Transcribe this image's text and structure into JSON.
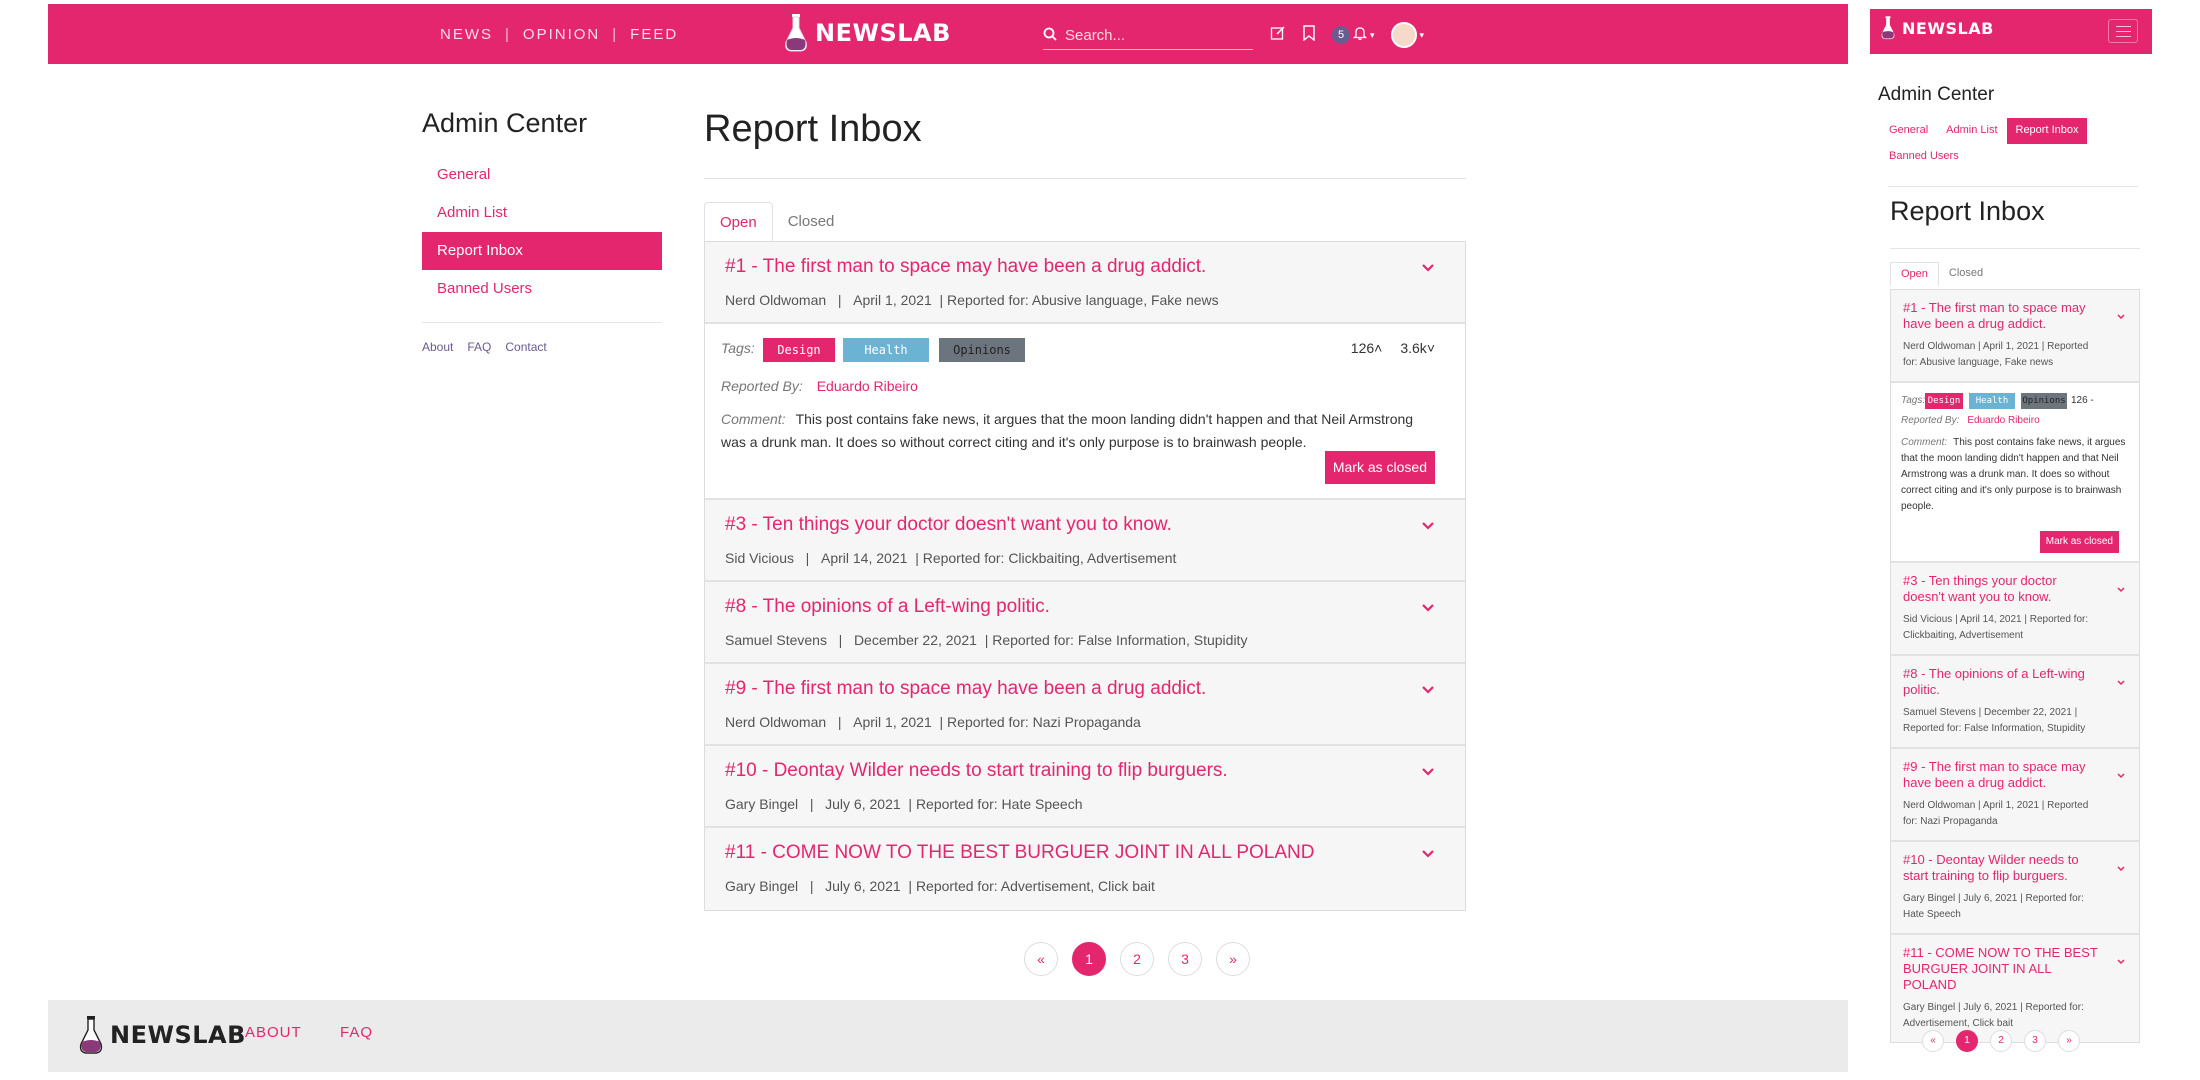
{
  "brand": {
    "name": "NEWSLAB"
  },
  "colors": {
    "accent": "#e4266f",
    "health": "#6ab3d2",
    "opinions": "#6c757d"
  },
  "nav": {
    "links": [
      "NEWS",
      "OPINION",
      "FEED"
    ],
    "search_placeholder": "Search...",
    "notification_count": "5"
  },
  "sidebar": {
    "title": "Admin Center",
    "items": [
      {
        "label": "General",
        "active": false
      },
      {
        "label": "Admin List",
        "active": false
      },
      {
        "label": "Report Inbox",
        "active": true
      },
      {
        "label": "Banned Users",
        "active": false
      }
    ],
    "footer_links": [
      "About",
      "FAQ",
      "Contact"
    ]
  },
  "main": {
    "title": "Report Inbox",
    "tabs": [
      {
        "label": "Open",
        "active": true
      },
      {
        "label": "Closed",
        "active": false
      }
    ],
    "reports": [
      {
        "title": "#1 - The first man to space may have been a drug addict.",
        "author": "Nerd Oldwoman",
        "date": "April 1, 2021",
        "reported_for": "| Reported for: Abusive language, Fake news"
      },
      {
        "title": "#3 - Ten things your doctor doesn't want you to know.",
        "author": "Sid Vicious",
        "date": "April 14, 2021",
        "reported_for": "| Reported for: Clickbaiting, Advertisement"
      },
      {
        "title": "#8 - The opinions of a Left-wing politic.",
        "author": "Samuel Stevens",
        "date": "December 22, 2021",
        "reported_for": "| Reported for: False Information, Stupidity"
      },
      {
        "title": "#9 - The first man to space may have been a drug addict.",
        "author": "Nerd Oldwoman",
        "date": "April 1, 2021",
        "reported_for": "| Reported for: Nazi Propaganda"
      },
      {
        "title": "#10 - Deontay Wilder needs to start training to flip burguers.",
        "author": "Gary Bingel",
        "date": "July 6, 2021",
        "reported_for": "| Reported for: Hate Speech"
      },
      {
        "title": "#11 - COME NOW TO THE BEST BURGUER JOINT IN ALL POLAND",
        "author": "Gary Bingel",
        "date": "July 6, 2021",
        "reported_for": "| Reported for: Advertisement, Click bait"
      }
    ],
    "detail": {
      "tags_label": "Tags:",
      "tags": [
        "Design",
        "Health",
        "Opinions"
      ],
      "upvotes": "126",
      "comments": "3.6k",
      "reported_by_label": "Reported By:",
      "reported_by": "Eduardo Ribeiro",
      "comment_label": "Comment:",
      "comment": "This post contains fake news, it argues that the moon landing didn't happen and that Neil Armstrong was a drunk man. It does so without correct citing and it's only purpose is to brainwash people.",
      "mark_button": "Mark as closed"
    },
    "pagination": [
      "«",
      "1",
      "2",
      "3",
      "»"
    ],
    "current_page": 1
  },
  "footer": {
    "links": [
      "ABOUT",
      "FAQ"
    ]
  },
  "mobile": {
    "upvotes": "126 -",
    "reports_meta": [
      "Nerd Oldwoman | April 1, 2021 | Reported for: Abusive language, Fake news",
      "Sid Vicious | April 14, 2021 | Reported for: Clickbaiting, Advertisement",
      "Samuel Stevens | December 22, 2021 | Reported for: False Information, Stupidity",
      "Nerd Oldwoman | April 1, 2021 | Reported for: Nazi Propaganda",
      "Gary Bingel | July 6, 2021 | Reported for: Hate Speech",
      "Gary Bingel | July 6, 2021 | Reported for: Advertisement, Click bait"
    ]
  }
}
